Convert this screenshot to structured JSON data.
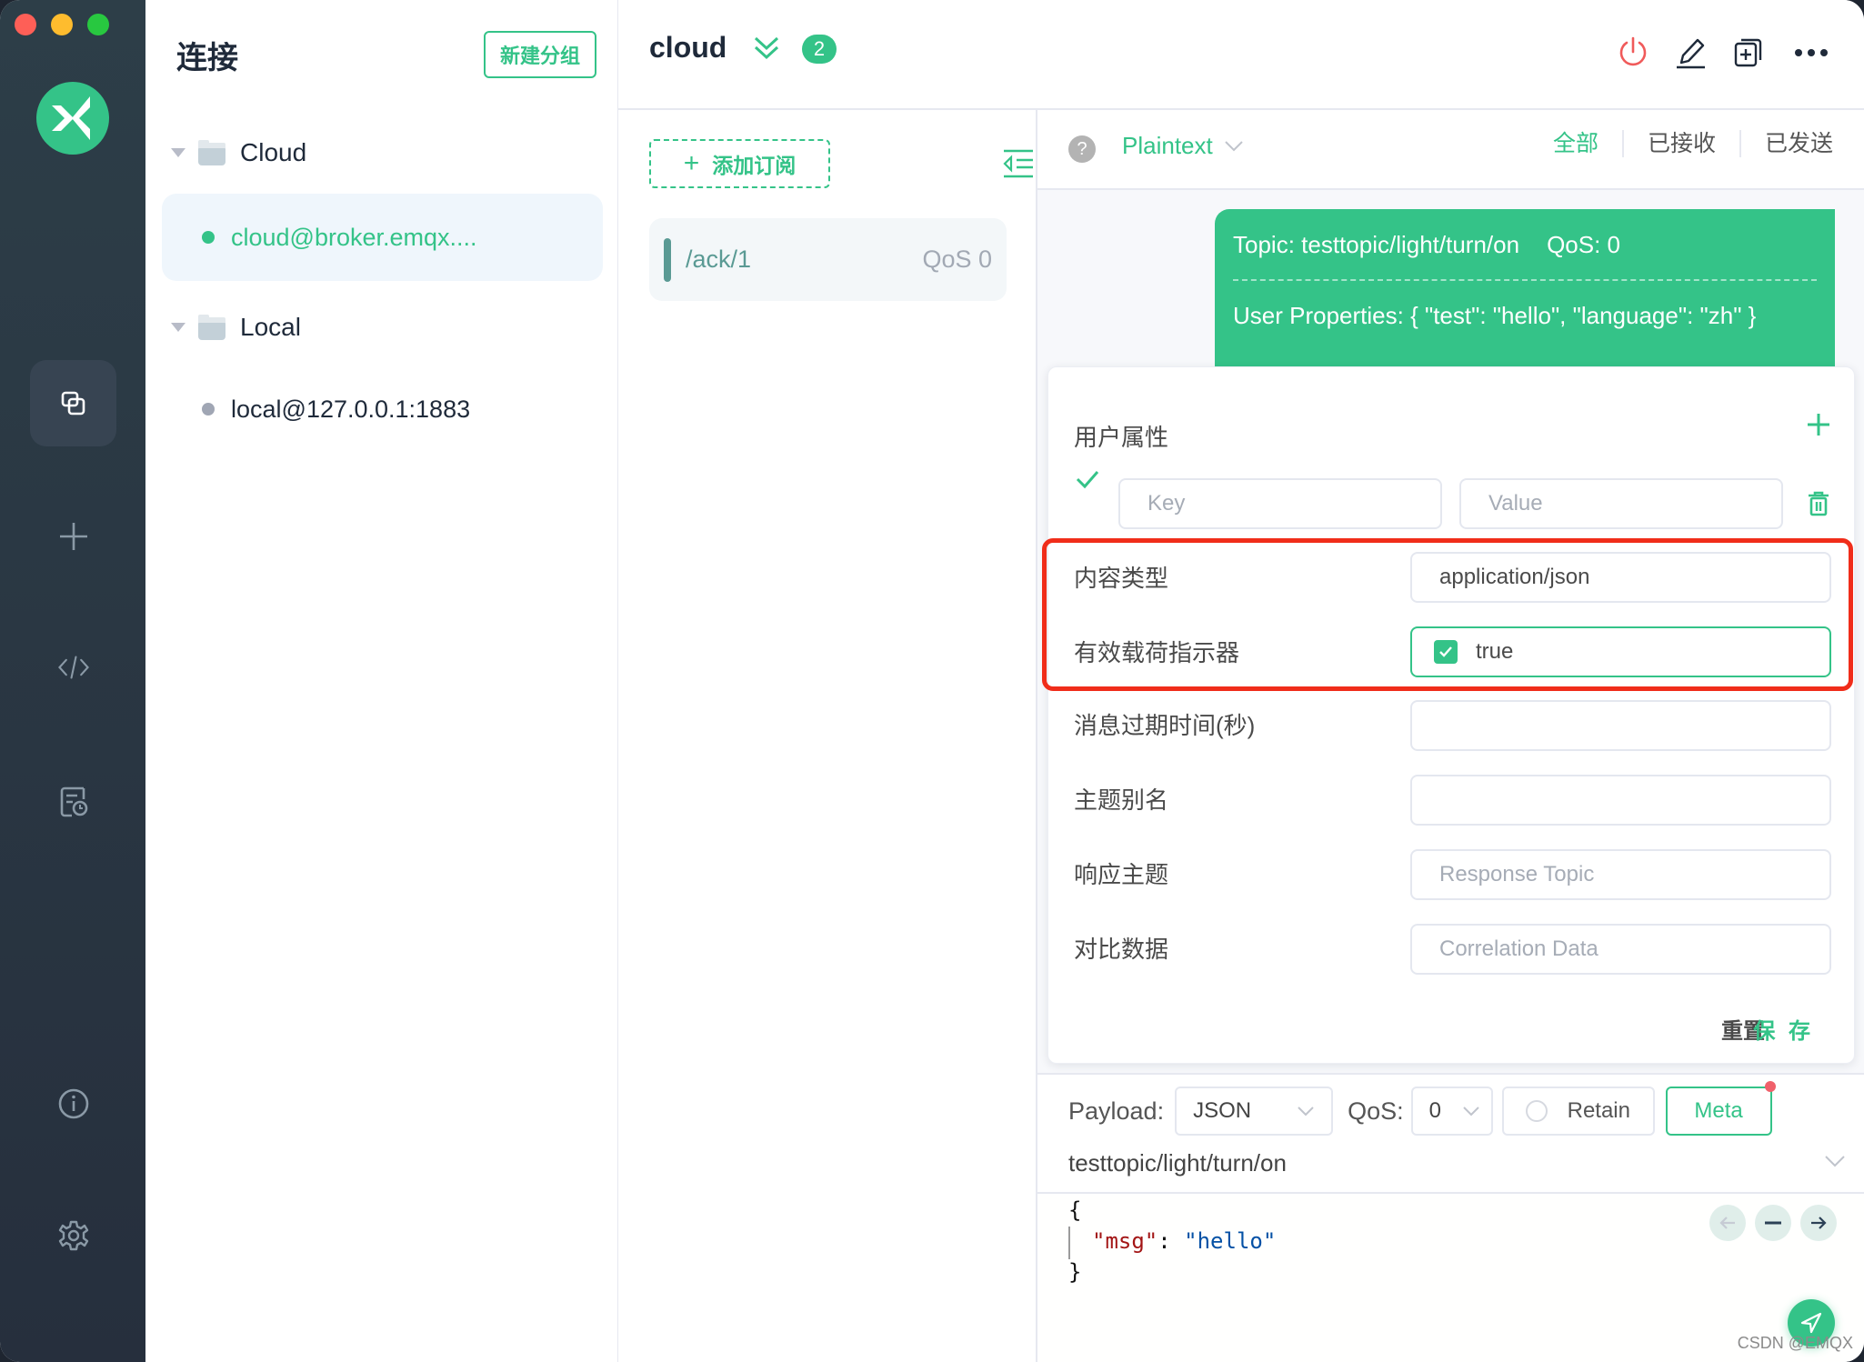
{
  "window": {
    "traffic_lights": [
      {
        "name": "close",
        "color": "#fe5f57"
      },
      {
        "name": "minimize",
        "color": "#febc2e"
      },
      {
        "name": "maximize",
        "color": "#28c840"
      }
    ]
  },
  "theme": {
    "accent": "#34c388",
    "nav_bg": "#2d3e48",
    "danger": "#f05a5a",
    "highlight": "#f02d1a"
  },
  "nav": {
    "logo": "mqttx-logo",
    "items": [
      {
        "icon": "connections-icon",
        "active": true
      },
      {
        "icon": "plus-icon",
        "active": false
      },
      {
        "icon": "code-icon",
        "active": false
      },
      {
        "icon": "log-icon",
        "active": false
      },
      {
        "icon": "info-icon",
        "active": false
      },
      {
        "icon": "gear-icon",
        "active": false
      }
    ]
  },
  "connections": {
    "title": "连接",
    "new_group_label": "新建分组",
    "groups": [
      {
        "name": "Cloud",
        "expanded": true,
        "items": [
          {
            "name": "cloud@broker.emqx....",
            "status": "connected",
            "status_color": "#34c388",
            "active": true
          }
        ]
      },
      {
        "name": "Local",
        "expanded": true,
        "items": [
          {
            "name": "local@127.0.0.1:1883",
            "status": "disconnected",
            "status_color": "#a0a6b4",
            "active": false
          }
        ]
      }
    ]
  },
  "header": {
    "title": "cloud",
    "badge_count": "2",
    "actions": [
      "disconnect-icon",
      "edit-icon",
      "new-window-icon",
      "more-icon"
    ]
  },
  "subscriptions": {
    "add_label": "添加订阅",
    "items": [
      {
        "topic": "/ack/1",
        "qos": "QoS 0",
        "color": "#5a9a94"
      }
    ]
  },
  "messages": {
    "format": "Plaintext",
    "filters": [
      {
        "label": "全部",
        "active": true
      },
      {
        "label": "已接收",
        "active": false
      },
      {
        "label": "已发送",
        "active": false
      }
    ],
    "list": [
      {
        "direction": "sent",
        "topic_line": "Topic: testtopic/light/turn/on",
        "qos_line": "QoS: 0",
        "user_properties": "User Properties: { \"test\": \"hello\", \"language\": \"zh\" }"
      }
    ]
  },
  "meta": {
    "user_props_label": "用户属性",
    "key_placeholder": "Key",
    "value_placeholder": "Value",
    "key_value": "",
    "value_value": "",
    "fields": [
      {
        "label": "内容类型",
        "value": "application/json",
        "placeholder": "",
        "type": "text"
      },
      {
        "label": "有效载荷指示器",
        "value": "true",
        "placeholder": "",
        "type": "checkbox",
        "checked": true
      },
      {
        "label": "消息过期时间(秒)",
        "value": "",
        "placeholder": "",
        "type": "text"
      },
      {
        "label": "主题别名",
        "value": "",
        "placeholder": "",
        "type": "text"
      },
      {
        "label": "响应主题",
        "value": "",
        "placeholder": "Response Topic",
        "type": "text"
      },
      {
        "label": "对比数据",
        "value": "",
        "placeholder": "Correlation Data",
        "type": "text"
      }
    ],
    "reset_label": "重置",
    "save_label": "保 存"
  },
  "publish": {
    "payload_label": "Payload:",
    "payload_format": "JSON",
    "qos_label": "QoS:",
    "qos_value": "0",
    "retain_label": "Retain",
    "retain_checked": false,
    "meta_label": "Meta",
    "meta_has_changes": true,
    "topic": "testtopic/light/turn/on",
    "payload_lines": {
      "open": "{",
      "key": "\"msg\"",
      "colon": ": ",
      "value": "\"hello\"",
      "close": "}"
    }
  },
  "watermark": "CSDN @EMQX"
}
